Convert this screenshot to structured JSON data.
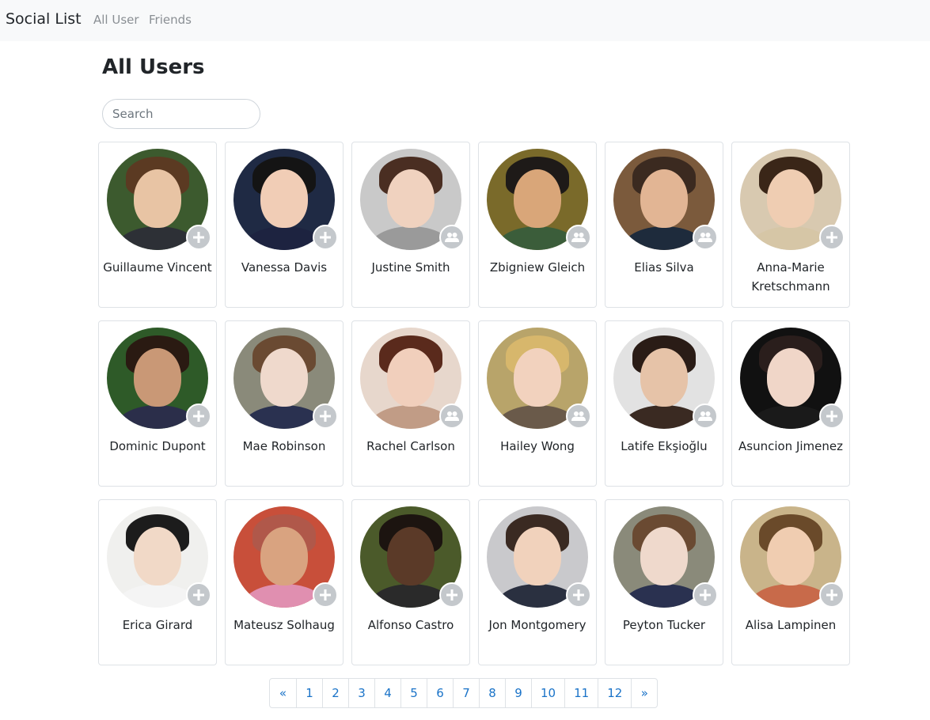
{
  "navbar": {
    "brand": "Social List",
    "links": [
      {
        "label": "All User"
      },
      {
        "label": "Friends"
      }
    ]
  },
  "page": {
    "title": "All Users",
    "search_placeholder": "Search"
  },
  "users": [
    {
      "name": "Guillaume Vincent",
      "action": "add"
    },
    {
      "name": "Vanessa Davis",
      "action": "add"
    },
    {
      "name": "Justine Smith",
      "action": "friends"
    },
    {
      "name": "Zbigniew Gleich",
      "action": "friends"
    },
    {
      "name": "Elias Silva",
      "action": "friends"
    },
    {
      "name": "Anna-Marie Kretschmann",
      "action": "add"
    },
    {
      "name": "Dominic Dupont",
      "action": "add"
    },
    {
      "name": "Mae Robinson",
      "action": "add"
    },
    {
      "name": "Rachel Carlson",
      "action": "friends"
    },
    {
      "name": "Hailey Wong",
      "action": "friends"
    },
    {
      "name": "Latife Ekşioğlu",
      "action": "friends"
    },
    {
      "name": "Asuncion Jimenez",
      "action": "add"
    },
    {
      "name": "Erica Girard",
      "action": "add"
    },
    {
      "name": "Mateusz Solhaug",
      "action": "add"
    },
    {
      "name": "Alfonso Castro",
      "action": "add"
    },
    {
      "name": "Jon Montgomery",
      "action": "add"
    },
    {
      "name": "Peyton Tucker",
      "action": "add"
    },
    {
      "name": "Alisa Lampinen",
      "action": "add"
    }
  ],
  "pagination": {
    "prev": "«",
    "pages": [
      "1",
      "2",
      "3",
      "4",
      "5",
      "6",
      "7",
      "8",
      "9",
      "10",
      "11",
      "12"
    ],
    "next": "»"
  }
}
